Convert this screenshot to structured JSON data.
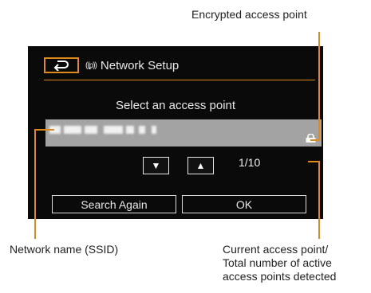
{
  "callouts": {
    "encrypted": "Encrypted access point",
    "ssid": "Network name (SSID)",
    "current_line1": "Current access point/",
    "current_line2": "Total number of active",
    "current_line3": "access points detected"
  },
  "screen": {
    "back_icon": "back-arrow-icon",
    "wifi_icon": "wifi-icon",
    "wifi_glyph": "((ᵱ))",
    "title": "Network Setup",
    "prompt": "Select an access point",
    "lock_icon": "lock-icon",
    "down_glyph": "▼",
    "up_glyph": "▲",
    "counter": "1/10",
    "search_again": "Search Again",
    "ok": "OK"
  },
  "colors": {
    "accent": "#e08a1e",
    "screen_bg": "#0a0a0a",
    "ap_row_bg": "#a3a3a3"
  }
}
